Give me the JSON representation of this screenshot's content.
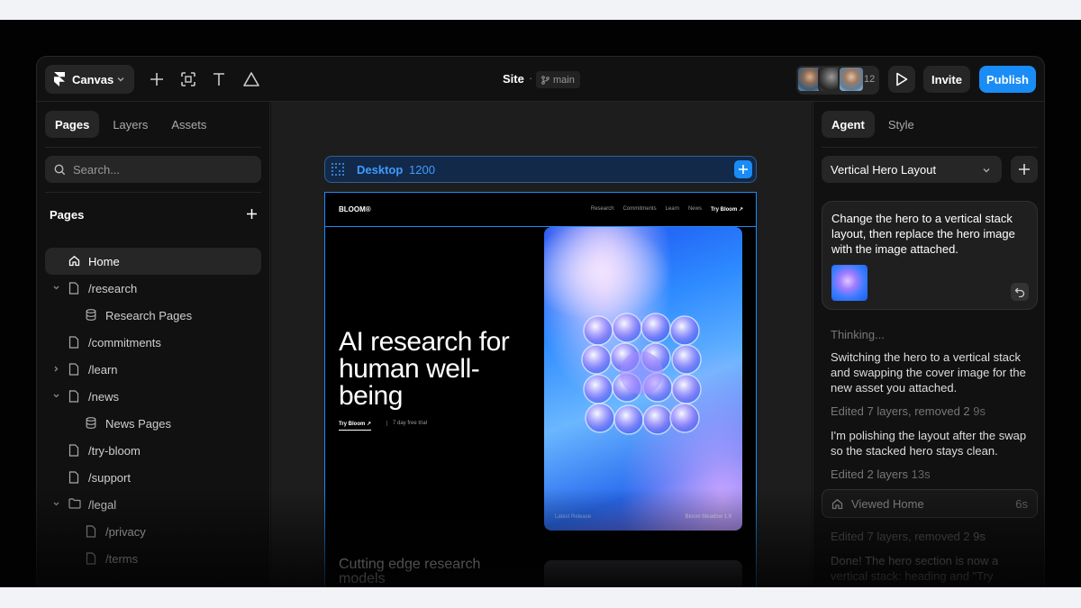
{
  "topbar": {
    "app_menu": "Canvas",
    "site_title": "Site",
    "separator": "·",
    "branch": "main",
    "collaborators_count": "12",
    "invite_label": "Invite",
    "publish_label": "Publish"
  },
  "left": {
    "tabs": [
      "Pages",
      "Layers",
      "Assets"
    ],
    "search_placeholder": "Search...",
    "pages_title": "Pages",
    "items": [
      {
        "label": "Home"
      },
      {
        "label": "/research"
      },
      {
        "label": "Research Pages"
      },
      {
        "label": "/commitments"
      },
      {
        "label": "/learn"
      },
      {
        "label": "/news"
      },
      {
        "label": "News Pages"
      },
      {
        "label": "/try-bloom"
      },
      {
        "label": "/support"
      },
      {
        "label": "/legal"
      },
      {
        "label": "/privacy"
      },
      {
        "label": "/terms"
      }
    ]
  },
  "canvas": {
    "frame_name": "Desktop",
    "frame_width": "1200",
    "site": {
      "logo": "BLOOM®",
      "nav": [
        "Research",
        "Commitments",
        "Learn",
        "News"
      ],
      "nav_cta": "Try Bloom ↗",
      "heading": "AI research for human well-being",
      "cta": "Try Bloom ↗",
      "trial": "7 day free trial",
      "hero_caption_left": "Latest Release",
      "hero_caption_right": "Bloom Meadow 1.9",
      "subheading": "Cutting edge research models"
    }
  },
  "right": {
    "tabs": [
      "Agent",
      "Style"
    ],
    "layout_select": "Vertical Hero Layout",
    "prompt": "Change the hero to a vertical stack layout, then replace the hero image with the image attached.",
    "messages": {
      "thinking": "Thinking...",
      "m1": "Switching the hero to a vertical stack and swapping the cover image for the new asset you attached.",
      "e1": "Edited 7 layers, removed 2",
      "e1_time": "9s",
      "m2": "I'm polishing the layout after the swap so the stacked hero stays clean.",
      "e2": "Edited 2 layers",
      "e2_time": "13s",
      "viewed": "Viewed Home",
      "viewed_time": "6s",
      "e3": "Edited 7 layers, removed 2",
      "e3_time": "9s",
      "done": "Done! The hero section is now a vertical stack: heading and \"Try"
    }
  },
  "colors": {
    "accent": "#1a8cf5",
    "background": "#111111",
    "panel": "#262626"
  }
}
